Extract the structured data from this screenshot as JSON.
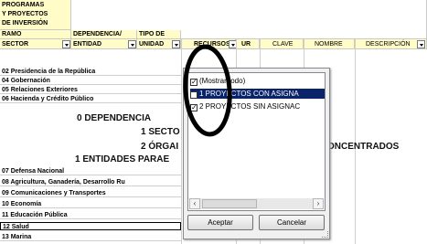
{
  "header": {
    "programas": [
      "PROGRAMAS",
      "Y PROYECTOS",
      "DE INVERSIÓN"
    ],
    "ramo": [
      "RAMO",
      "SECTOR"
    ],
    "dependencia": [
      "DEPENDENCIA/",
      "ENTIDAD"
    ],
    "tipo": [
      "TIPO DE",
      "UNIDAD"
    ],
    "recursos": "RECURSOS",
    "ur": "UR",
    "clave": "CLAVE",
    "nombre": "NOMBRE",
    "descripcion": "DESCRIPCIÓN"
  },
  "rows": [
    "02 Presidencia de la República",
    "04 Gobernación",
    "05 Relaciones Exteriores",
    "06 Hacienda y Crédito Público"
  ],
  "big_rows": {
    "dependencia": "0 DEPENDENCIA",
    "secto": "1 SECTO",
    "organ": "2 ÓRGAI",
    "concentrados": "ONCENTRADOS",
    "entidades": "1 ENTIDADES PARAE"
  },
  "rows2": [
    "07 Defensa Nacional",
    "08 Agricultura, Ganadería, Desarrollo Ru",
    "09 Comunicaciones y Transportes",
    "10 Economía",
    "11 Educación Pública",
    "12 Salud",
    "13 Marina"
  ],
  "filter_popup": {
    "options": [
      {
        "label": "(Mostrar todo)",
        "checked": true
      },
      {
        "label": "1 PROYECTOS CON ASIGNA",
        "checked": true
      },
      {
        "label": "2 PROYECTOS SIN ASIGNAC",
        "checked": true
      }
    ],
    "accept_label": "Aceptar",
    "cancel_label": "Cancelar"
  },
  "annotation_color": "#000000"
}
